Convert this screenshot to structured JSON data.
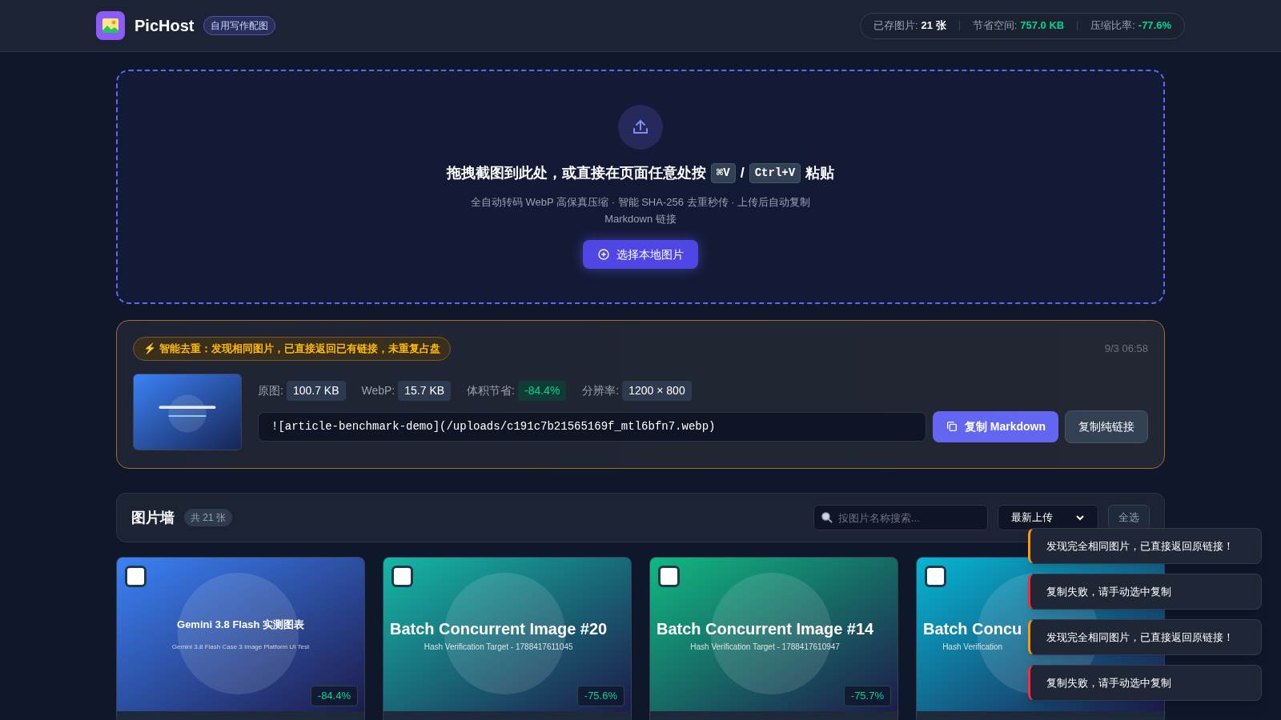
{
  "header": {
    "app_name": "PicHost",
    "tag": "自用写作配图",
    "stats": [
      {
        "label": "已存图片:",
        "value": "21 张",
        "kind": "plain"
      },
      {
        "label": "节省空间:",
        "value": "757.0 KB",
        "kind": "good"
      },
      {
        "label": "压缩比率:",
        "value": "-77.6%",
        "kind": "good"
      }
    ]
  },
  "dropzone": {
    "title_before": "拖拽截图到此处，或直接在页面任意处按",
    "keys": [
      "⌘V",
      "Ctrl+V"
    ],
    "separator": "/",
    "title_after": "粘贴",
    "subtitle": "全自动转码 WebP 高保真压缩 · 智能 SHA-256 去重秒传 · 上传后自动复制 Markdown 链接",
    "button": "选择本地图片"
  },
  "result": {
    "notice": "⚡ 智能去重：发现相同图片，已直接返回已有链接，未重复占盘",
    "time": "9/3 06:58",
    "stats": [
      {
        "label": "原图:",
        "value": "100.7 KB",
        "kind": "plain"
      },
      {
        "label": "WebP:",
        "value": "15.7 KB",
        "kind": "plain"
      },
      {
        "label": "体积节省:",
        "value": "-84.4%",
        "kind": "good"
      },
      {
        "label": "分辨率:",
        "value": "1200 × 800",
        "kind": "plain"
      }
    ],
    "markdown": "![article-benchmark-demo](/uploads/c191c7b21565169f_mtl6bfn7.webp)",
    "copy_markdown": "复制 Markdown",
    "copy_link": "复制纯链接"
  },
  "gallery": {
    "title": "图片墙",
    "count": "共 21 张",
    "search_placeholder": "按图片名称搜索...",
    "sort": "最新上传",
    "select_all": "全选",
    "cards": [
      {
        "kind": "chart",
        "title": "Gemini 3.8 Flash 实测图表",
        "subtitle": "Gemini 3.8 Flash Case 3 Image Platform UI Test",
        "ratio": "-84.4%",
        "selected": false,
        "color": "#3b82f6"
      },
      {
        "kind": "batch",
        "title": "Batch Concurrent Image #20",
        "subtitle": "Hash Verification Target - 1788417611045",
        "ratio": "-75.6%",
        "selected": false,
        "color": "#14b8a6"
      },
      {
        "kind": "batch",
        "title": "Batch Concurrent Image #14",
        "subtitle": "Hash Verification Target - 1788417610947",
        "ratio": "-75.7%",
        "selected": false,
        "color": "#10b981"
      },
      {
        "kind": "batch",
        "title": "Batch Concu",
        "subtitle": "Hash Verification",
        "selected": false,
        "color": "#06b6d4"
      }
    ]
  },
  "toasts": [
    {
      "kind": "warning",
      "text": "发现完全相同图片，已直接返回原链接！"
    },
    {
      "kind": "error",
      "text": "复制失败，请手动选中复制"
    },
    {
      "kind": "warning",
      "text": "发现完全相同图片，已直接返回原链接！"
    },
    {
      "kind": "error",
      "text": "复制失败，请手动选中复制"
    }
  ]
}
